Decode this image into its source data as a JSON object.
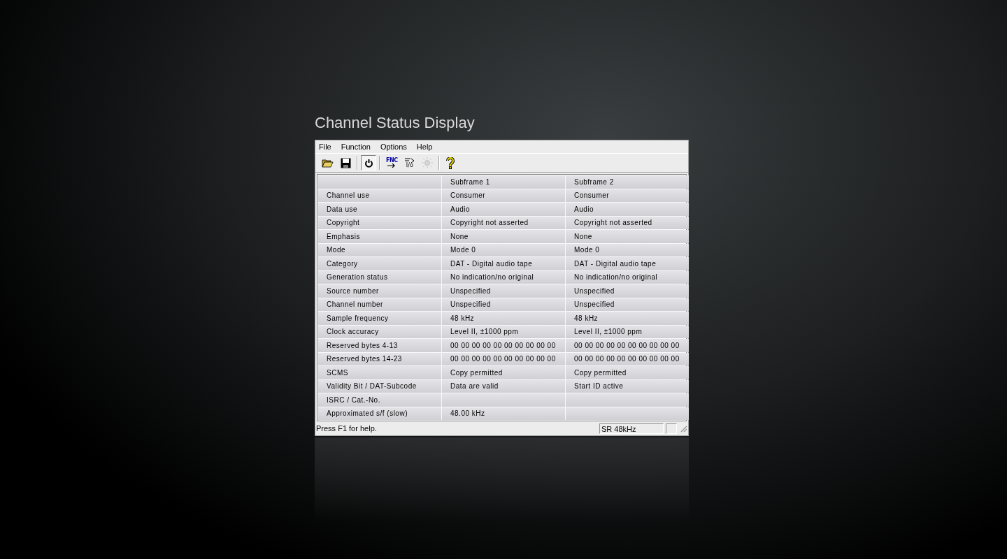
{
  "heading": "Channel Status Display",
  "window": {
    "menu": [
      "File",
      "Function",
      "Options",
      "Help"
    ],
    "toolbar": [
      {
        "kind": "open",
        "pressed": false,
        "disabled": false
      },
      {
        "kind": "save",
        "pressed": false,
        "disabled": false
      },
      {
        "kind": "power",
        "pressed": true,
        "disabled": false
      },
      {
        "kind": "fnc",
        "label": "FNC",
        "pressed": false,
        "disabled": false
      },
      {
        "kind": "io",
        "label": "I/o",
        "pressed": false,
        "disabled": false
      },
      {
        "kind": "light",
        "pressed": false,
        "disabled": true
      },
      {
        "kind": "help",
        "pressed": false,
        "disabled": false
      }
    ],
    "table": {
      "columns": [
        "Subframe 1",
        "Subframe 2"
      ],
      "rows": [
        {
          "label": "Channel use",
          "subframe_1": "Consumer",
          "subframe_2": "Consumer"
        },
        {
          "label": "Data use",
          "subframe_1": "Audio",
          "subframe_2": "Audio"
        },
        {
          "label": "Copyright",
          "subframe_1": "Copyright not asserted",
          "subframe_2": "Copyright not asserted"
        },
        {
          "label": "Emphasis",
          "subframe_1": "None",
          "subframe_2": "None"
        },
        {
          "label": "Mode",
          "subframe_1": "Mode 0",
          "subframe_2": "Mode 0"
        },
        {
          "label": "Category",
          "subframe_1": "DAT - Digital audio tape",
          "subframe_2": "DAT - Digital audio tape"
        },
        {
          "label": "Generation status",
          "subframe_1": "No indication/no original",
          "subframe_2": "No indication/no original"
        },
        {
          "label": "Source number",
          "subframe_1": "Unspecified",
          "subframe_2": "Unspecified"
        },
        {
          "label": "Channel number",
          "subframe_1": "Unspecified",
          "subframe_2": "Unspecified"
        },
        {
          "label": "Sample frequency",
          "subframe_1": "48 kHz",
          "subframe_2": "48 kHz"
        },
        {
          "label": "Clock accuracy",
          "subframe_1": "Level II, ±1000 ppm",
          "subframe_2": "Level II, ±1000 ppm"
        },
        {
          "label": "Reserved bytes 4-13",
          "subframe_1": "00 00 00 00 00 00 00 00 00 00",
          "subframe_2": "00 00 00 00 00 00 00 00 00 00"
        },
        {
          "label": "Reserved bytes 14-23",
          "subframe_1": "00 00 00 00 00 00 00 00 00 00",
          "subframe_2": "00 00 00 00 00 00 00 00 00 00"
        },
        {
          "label": "SCMS",
          "subframe_1": "Copy permitted",
          "subframe_2": "Copy permitted"
        },
        {
          "label": "Validity Bit / DAT-Subcode",
          "subframe_1": "Data are valid",
          "subframe_2": "Start ID active"
        },
        {
          "label": "ISRC / Cat.-No."
        },
        {
          "label": "Approximated s/f (slow)",
          "subframe_1": "48.00 kHz"
        }
      ]
    },
    "status_bar": {
      "message": "Press F1 for help.",
      "sample_rate": "SR 48kHz"
    }
  }
}
